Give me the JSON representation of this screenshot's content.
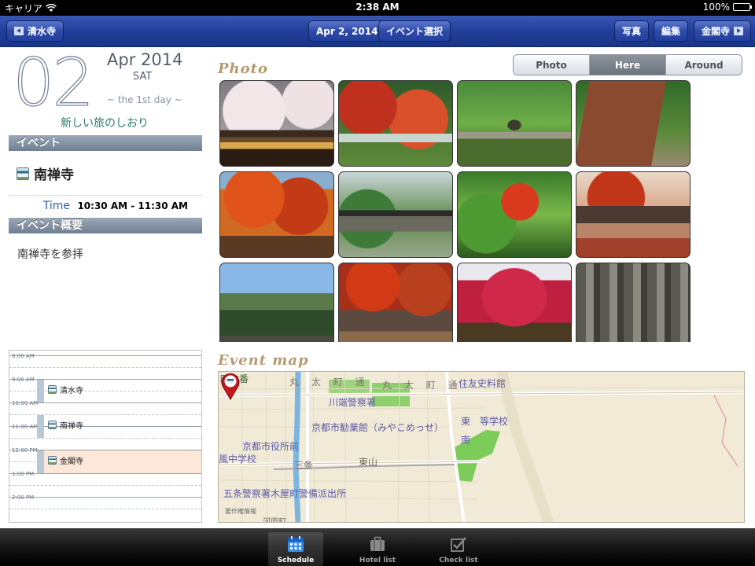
{
  "status_bar": {
    "carrier": "キャリア",
    "time": "2:38 AM",
    "battery": "100%",
    "battery_level": 1.0
  },
  "nav": {
    "back_label": "清水寺",
    "date_label": "Apr 2, 2014",
    "event_select_label": "イベント選択",
    "photo_label": "写真",
    "edit_label": "編集",
    "next_label": "金閣寺"
  },
  "date": {
    "day": "02",
    "month_year": "Apr 2014",
    "weekday": "SAT",
    "day_count": "~ the 1st day ~"
  },
  "trip_name": "新しい旅のしおり",
  "event": {
    "section_label": "イベント",
    "title": "南禅寺",
    "time_label": "Time",
    "time_value": "10:30 AM - 11:30 AM",
    "summary_section_label": "イベント概要",
    "summary": "南禅寺を参拝"
  },
  "timeline": {
    "hours": [
      "8:00 AM",
      "9:00 AM",
      "10:00 AM",
      "11:00 AM",
      "12:00 PM",
      "1:00 PM",
      "2:00 PM"
    ],
    "events": [
      {
        "label": "清水寺",
        "start_hour": 9.0,
        "end_hour": 10.0,
        "current": false
      },
      {
        "label": "南禅寺",
        "start_hour": 10.5,
        "end_hour": 11.5,
        "current": false
      },
      {
        "label": "金閣寺",
        "start_hour": 12.0,
        "end_hour": 13.0,
        "current": true
      }
    ]
  },
  "photo_section": {
    "title": "Photo",
    "segments": [
      {
        "label": "Photo",
        "selected": false
      },
      {
        "label": "Here",
        "selected": true
      },
      {
        "label": "Around",
        "selected": false
      }
    ],
    "photos": [
      {
        "subject": "cherry-blossom-temple-gate"
      },
      {
        "subject": "red-maple-bridge"
      },
      {
        "subject": "green-maple-path"
      },
      {
        "subject": "brick-aqueduct"
      },
      {
        "subject": "orange-maple-tree"
      },
      {
        "subject": "temple-roof-garden"
      },
      {
        "subject": "green-red-maples"
      },
      {
        "subject": "red-maple-temple-roof"
      },
      {
        "subject": "mountain-view"
      },
      {
        "subject": "autumn-crowd-path"
      },
      {
        "subject": "red-maple-canopy"
      },
      {
        "subject": "stone-lanterns"
      }
    ]
  },
  "map": {
    "title": "Event map",
    "labels": {
      "machi_bunko": "町文番",
      "marutamachi_1": "丸 太 町 通",
      "marutamachi_2": "丸 太 町 通",
      "sumitomo": "住友史料館",
      "kawabata_police": "川端警察署",
      "miyako_messe": "京都市勧業館（みやこめっせ）",
      "higashiyama_school": "東　等学校",
      "nan": "南",
      "city_hall": "京都市役所前",
      "sanjo": "三条",
      "higashiyama": "東山",
      "chugakko": "風中学校",
      "gojo_police": "五条警察署木屋町警備派出所",
      "credits": "著作権情報",
      "kawaramachi": "河原町"
    }
  },
  "tabs": [
    {
      "label": "Schedule",
      "selected": true
    },
    {
      "label": "Hotel list",
      "selected": false
    },
    {
      "label": "Check list",
      "selected": false
    }
  ],
  "colors": {
    "nav_blue": "#213f99",
    "accent_tan": "#b59a73",
    "trip_teal": "#2c7a6b"
  }
}
